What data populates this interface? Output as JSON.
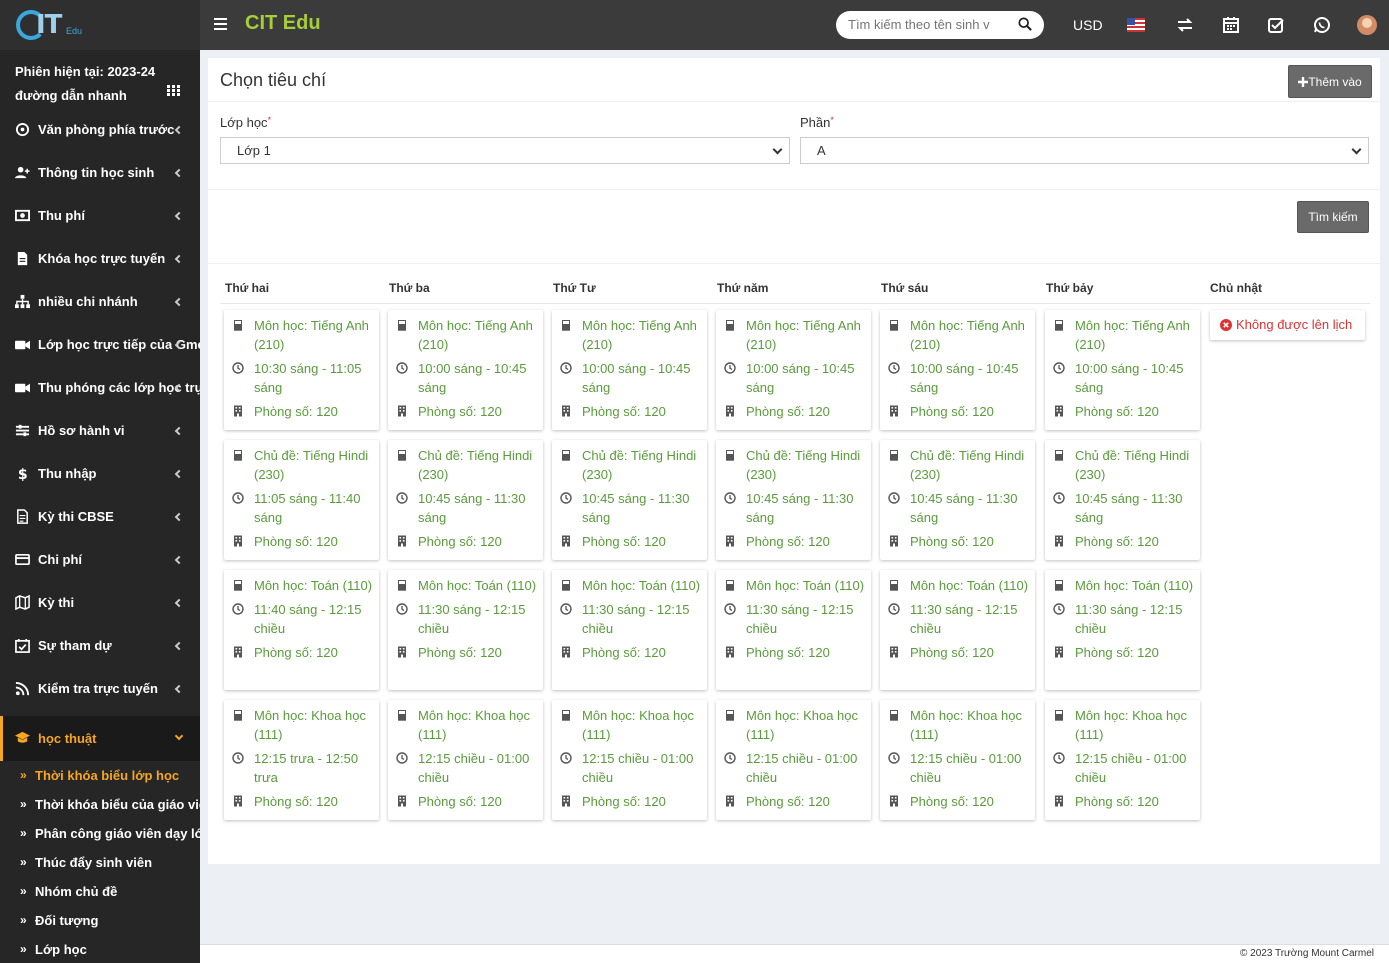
{
  "header": {
    "brand": "CIT Edu",
    "logo_text": "IT",
    "logo_sub": "Edu",
    "search_placeholder": "Tìm kiếm theo tên sinh v",
    "currency": "USD",
    "icons": [
      "search-icon",
      "flag-us-icon",
      "swap-icon",
      "calendar-icon",
      "check-square-icon",
      "whatsapp-icon",
      "user-avatar"
    ]
  },
  "sidebar": {
    "session": "Phiên hiện tại: 2023-24",
    "quick_links": "đường dẫn nhanh",
    "items": [
      {
        "label": "Văn phòng phía trước",
        "icon": "eye-icon"
      },
      {
        "label": "Thông tin học sinh",
        "icon": "user-plus-icon"
      },
      {
        "label": "Thu phí",
        "icon": "money-icon"
      },
      {
        "label": "Khóa học trực tuyến",
        "icon": "file-icon"
      },
      {
        "label": "nhiều chi nhánh",
        "icon": "sitemap-icon"
      },
      {
        "label": "Lớp học trực tiếp của Gmeet",
        "icon": "video-icon"
      },
      {
        "label": "Thu phóng các lớp học trực tiếp",
        "icon": "video-icon"
      },
      {
        "label": "Hồ sơ hành vi",
        "icon": "sliders-icon"
      },
      {
        "label": "Thu nhập",
        "icon": "dollar-icon"
      },
      {
        "label": "Kỳ thi CBSE",
        "icon": "file-text-icon"
      },
      {
        "label": "Chi phí",
        "icon": "credit-card-icon"
      },
      {
        "label": "Kỳ thi",
        "icon": "map-icon"
      },
      {
        "label": "Sự tham dự",
        "icon": "calendar-check-icon"
      },
      {
        "label": "Kiểm tra trực tuyến",
        "icon": "rss-icon"
      }
    ],
    "active": {
      "label": "học thuật",
      "icon": "graduation-cap-icon"
    },
    "subitems": [
      "Thời khóa biểu lớp học",
      "Thời khóa biểu của giáo viên",
      "Phân công giáo viên dạy lớp",
      "Thúc đẩy sinh viên",
      "Nhóm chủ đề",
      "Đối tượng",
      "Lớp học"
    ]
  },
  "main": {
    "title": "Chọn tiêu chí",
    "add_button": "Thêm vào",
    "class_label": "Lớp học",
    "class_value": "Lớp 1",
    "section_label": "Phần",
    "section_value": "A",
    "search_button": "Tìm kiếm",
    "days": [
      "Thứ hai",
      "Thứ ba",
      "Thứ Tư",
      "Thứ năm",
      "Thứ sáu",
      "Thứ bảy",
      "Chủ nhật"
    ],
    "no_schedule": "Không được lên lịch",
    "rows": [
      [
        {
          "subject": "Môn học: Tiếng Anh (210)",
          "time": "10:30 sáng - 11:05 sáng",
          "room": "Phòng số: 120"
        },
        {
          "subject": "Môn học: Tiếng Anh (210)",
          "time": "10:00 sáng - 10:45 sáng",
          "room": "Phòng số: 120"
        },
        {
          "subject": "Môn học: Tiếng Anh (210)",
          "time": "10:00 sáng - 10:45 sáng",
          "room": "Phòng số: 120"
        },
        {
          "subject": "Môn học: Tiếng Anh (210)",
          "time": "10:00 sáng - 10:45 sáng",
          "room": "Phòng số: 120"
        },
        {
          "subject": "Môn học: Tiếng Anh (210)",
          "time": "10:00 sáng - 10:45 sáng",
          "room": "Phòng số: 120"
        },
        {
          "subject": "Môn học: Tiếng Anh (210)",
          "time": "10:00 sáng - 10:45 sáng",
          "room": "Phòng số: 120"
        }
      ],
      [
        {
          "subject": "Chủ đề: Tiếng Hindi (230)",
          "time": "11:05 sáng - 11:40 sáng",
          "room": "Phòng số: 120"
        },
        {
          "subject": "Chủ đề: Tiếng Hindi (230)",
          "time": "10:45 sáng - 11:30 sáng",
          "room": "Phòng số: 120"
        },
        {
          "subject": "Chủ đề: Tiếng Hindi (230)",
          "time": "10:45 sáng - 11:30 sáng",
          "room": "Phòng số: 120"
        },
        {
          "subject": "Chủ đề: Tiếng Hindi (230)",
          "time": "10:45 sáng - 11:30 sáng",
          "room": "Phòng số: 120"
        },
        {
          "subject": "Chủ đề: Tiếng Hindi (230)",
          "time": "10:45 sáng - 11:30 sáng",
          "room": "Phòng số: 120"
        },
        {
          "subject": "Chủ đề: Tiếng Hindi (230)",
          "time": "10:45 sáng - 11:30 sáng",
          "room": "Phòng số: 120"
        }
      ],
      [
        {
          "subject": "Môn học: Toán (110)",
          "time": "11:40 sáng - 12:15 chiều",
          "room": "Phòng số: 120"
        },
        {
          "subject": "Môn học: Toán (110)",
          "time": "11:30 sáng - 12:15 chiều",
          "room": "Phòng số: 120"
        },
        {
          "subject": "Môn học: Toán (110)",
          "time": "11:30 sáng - 12:15 chiều",
          "room": "Phòng số: 120"
        },
        {
          "subject": "Môn học: Toán (110)",
          "time": "11:30 sáng - 12:15 chiều",
          "room": "Phòng số: 120"
        },
        {
          "subject": "Môn học: Toán (110)",
          "time": "11:30 sáng - 12:15 chiều",
          "room": "Phòng số: 120"
        },
        {
          "subject": "Môn học: Toán (110)",
          "time": "11:30 sáng - 12:15 chiều",
          "room": "Phòng số: 120"
        }
      ],
      [
        {
          "subject": "Môn học: Khoa học (111)",
          "time": "12:15 trưa - 12:50 trưa",
          "room": "Phòng số: 120"
        },
        {
          "subject": "Môn học: Khoa học (111)",
          "time": "12:15 chiều - 01:00 chiều",
          "room": "Phòng số: 120"
        },
        {
          "subject": "Môn học: Khoa học (111)",
          "time": "12:15 chiều - 01:00 chiều",
          "room": "Phòng số: 120"
        },
        {
          "subject": "Môn học: Khoa học (111)",
          "time": "12:15 chiều - 01:00 chiều",
          "room": "Phòng số: 120"
        },
        {
          "subject": "Môn học: Khoa học (111)",
          "time": "12:15 chiều - 01:00 chiều",
          "room": "Phòng số: 120"
        },
        {
          "subject": "Môn học: Khoa học (111)",
          "time": "12:15 chiều - 01:00 chiều",
          "room": "Phòng số: 120"
        }
      ]
    ]
  },
  "footer": "© 2023 Trường Mount Carmel"
}
